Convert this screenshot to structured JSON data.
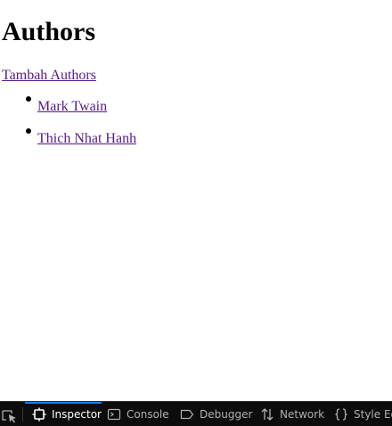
{
  "page": {
    "heading": "Authors",
    "add_link": "Tambah Authors",
    "authors": [
      {
        "name": "Mark Twain"
      },
      {
        "name": "Thich Nhat Hanh"
      }
    ]
  },
  "devtools": {
    "tabs": [
      {
        "label": "Inspector",
        "icon": "inspector-icon",
        "active": true
      },
      {
        "label": "Console",
        "icon": "console-icon",
        "active": false
      },
      {
        "label": "Debugger",
        "icon": "debugger-icon",
        "active": false
      },
      {
        "label": "Network",
        "icon": "network-icon",
        "active": false
      },
      {
        "label": "Style Ed",
        "icon": "style-editor-icon",
        "active": false
      }
    ],
    "accent_color": "#0a84ff",
    "background_color": "#0c0c0d"
  }
}
